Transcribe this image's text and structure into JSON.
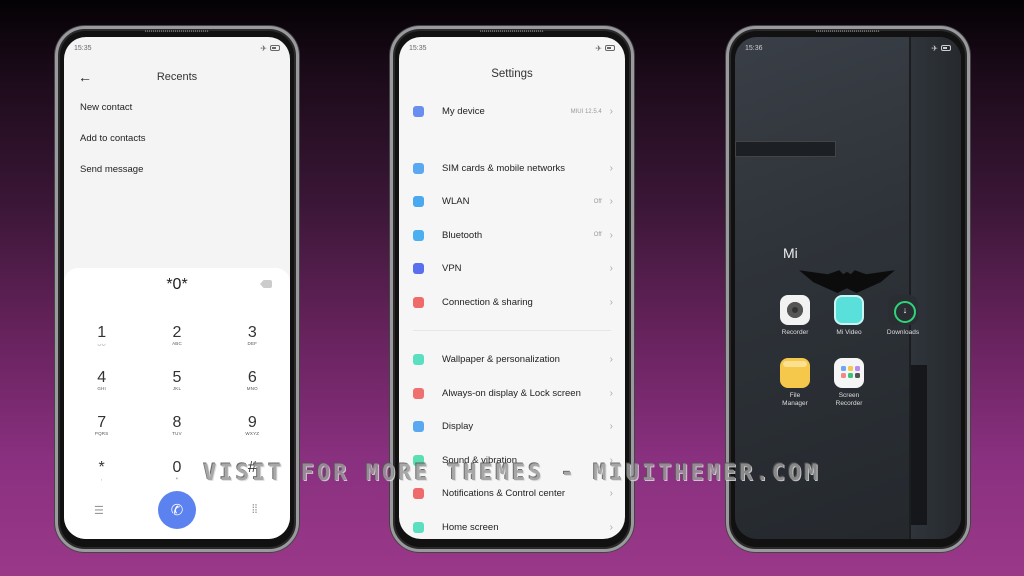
{
  "phones": {
    "dialer": {
      "status": {
        "time": "15:35",
        "icons": [
          "airplane-icon",
          "battery-icon"
        ]
      },
      "title": "Recents",
      "menu": [
        "New contact",
        "Add to contacts",
        "Send message"
      ],
      "number": "*0*",
      "keys": [
        {
          "digit": "1",
          "letters": "◡◡"
        },
        {
          "digit": "2",
          "letters": "ABC"
        },
        {
          "digit": "3",
          "letters": "DEF"
        },
        {
          "digit": "4",
          "letters": "GHI"
        },
        {
          "digit": "5",
          "letters": "JKL"
        },
        {
          "digit": "6",
          "letters": "MNO"
        },
        {
          "digit": "7",
          "letters": "PQRS"
        },
        {
          "digit": "8",
          "letters": "TUV"
        },
        {
          "digit": "9",
          "letters": "WXYZ"
        },
        {
          "digit": "*",
          "letters": ","
        },
        {
          "digit": "0",
          "letters": "+"
        },
        {
          "digit": "#",
          "letters": ""
        }
      ],
      "call_color": "#5b82ef"
    },
    "settings": {
      "status": {
        "time": "15:35"
      },
      "title": "Settings",
      "groups": [
        [
          {
            "label": "My device",
            "value": "MIUI 12.5.4",
            "icon": "phone-icon",
            "color": "#6a8ef0"
          }
        ],
        [
          {
            "label": "SIM cards & mobile networks",
            "value": "",
            "icon": "sim-icon",
            "color": "#5aa8f0"
          },
          {
            "label": "WLAN",
            "value": "Off",
            "icon": "wifi-icon",
            "color": "#4aa8f0"
          },
          {
            "label": "Bluetooth",
            "value": "Off",
            "icon": "bluetooth-icon",
            "color": "#4ab0f0"
          },
          {
            "label": "VPN",
            "value": "",
            "icon": "vpn-icon",
            "color": "#5a6ef0"
          },
          {
            "label": "Connection & sharing",
            "value": "",
            "icon": "connection-icon",
            "color": "#f06a6a"
          }
        ],
        [
          {
            "label": "Wallpaper & personalization",
            "value": "",
            "icon": "wallpaper-icon",
            "color": "#5ae0c0"
          },
          {
            "label": "Always-on display & Lock screen",
            "value": "",
            "icon": "lock-icon",
            "color": "#f07070"
          },
          {
            "label": "Display",
            "value": "",
            "icon": "display-icon",
            "color": "#5aa8f0"
          },
          {
            "label": "Sound & vibration",
            "value": "",
            "icon": "sound-icon",
            "color": "#5ae0b0"
          },
          {
            "label": "Notifications & Control center",
            "value": "",
            "icon": "notifications-icon",
            "color": "#f06a6a"
          },
          {
            "label": "Home screen",
            "value": "",
            "icon": "home-icon",
            "color": "#5ae0c0"
          }
        ]
      ]
    },
    "home": {
      "status": {
        "time": "15:36"
      },
      "folder": "Mi",
      "apps": [
        {
          "label": "Recorder",
          "icon": "recorder-icon"
        },
        {
          "label": "Mi Video",
          "icon": "mi-video-icon"
        },
        {
          "label": "Downloads",
          "icon": "downloads-icon"
        },
        {
          "label": "File Manager",
          "icon": "file-manager-icon"
        },
        {
          "label": "Screen Recorder",
          "icon": "screen-recorder-icon"
        }
      ]
    }
  },
  "watermark": "VISIT FOR MORE THEMES - MIUITHEMER.COM"
}
